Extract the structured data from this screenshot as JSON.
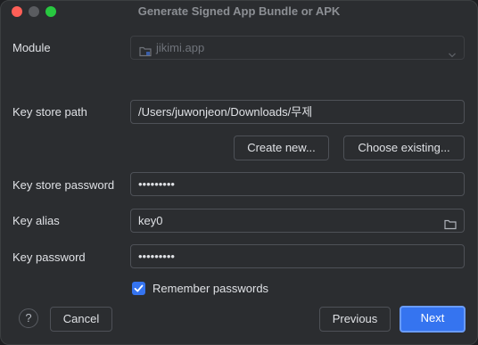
{
  "window": {
    "title": "Generate Signed App Bundle or APK"
  },
  "module": {
    "label": "Module",
    "value": "jikimi.app"
  },
  "keystore": {
    "path_label": "Key store path",
    "path_value": "/Users/juwonjeon/Downloads/무제",
    "create_label": "Create new...",
    "choose_label": "Choose existing...",
    "password_label": "Key store password",
    "password_value": "•••••••••"
  },
  "key": {
    "alias_label": "Key alias",
    "alias_value": "key0",
    "password_label": "Key password",
    "password_value": "•••••••••"
  },
  "remember": {
    "label": "Remember passwords",
    "checked": true
  },
  "footer": {
    "help_label": "?",
    "cancel_label": "Cancel",
    "previous_label": "Previous",
    "next_label": "Next"
  },
  "colors": {
    "accent": "#3574f0",
    "background": "#2b2d30",
    "border": "#4e5157"
  },
  "icons": [
    "folder-icon",
    "chevron-down-icon",
    "check-icon"
  ]
}
